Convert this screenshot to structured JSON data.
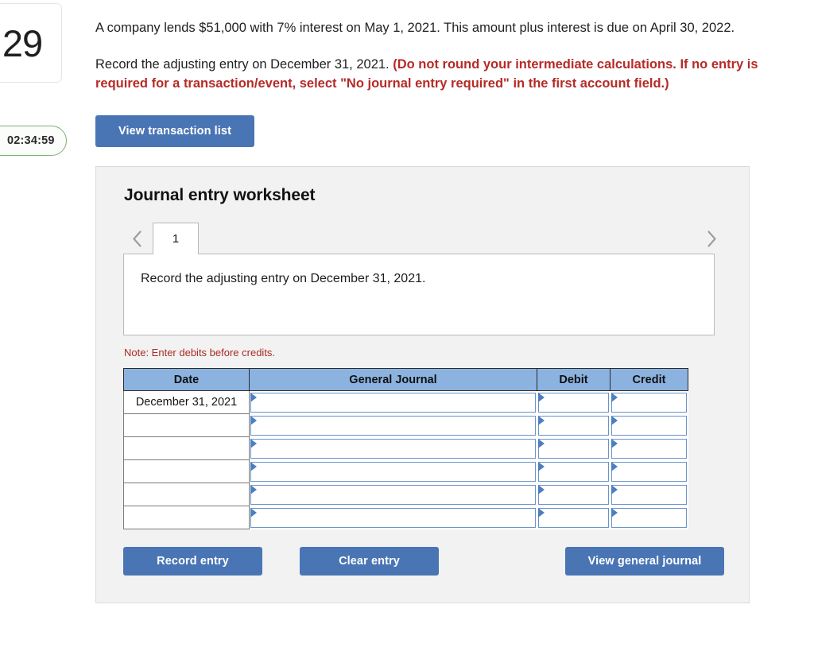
{
  "question": {
    "number": "29",
    "timer": "02:34:59",
    "timer_icon": "hourglass-icon"
  },
  "prompt": {
    "paragraph_1": "A company lends $51,000 with 7% interest on May 1, 2021. This amount plus interest is due on April 30, 2022.",
    "paragraph_2_plain": "Record the adjusting entry on December 31, 2021. ",
    "paragraph_2_emphasis": "(Do not round your intermediate calculations. If no entry is required for a transaction/event, select \"No journal entry required\" in the first account field.)"
  },
  "toolbar": {
    "view_transaction_list_label": "View transaction list"
  },
  "worksheet": {
    "title": "Journal entry worksheet",
    "prev_icon": "chevron-left-icon",
    "next_icon": "chevron-right-icon",
    "tabs": [
      {
        "label": "1",
        "active": true
      }
    ],
    "instruction": "Record the adjusting entry on December 31, 2021.",
    "note": "Note: Enter debits before credits.",
    "table": {
      "columns": [
        "Date",
        "General Journal",
        "Debit",
        "Credit"
      ],
      "rows": [
        {
          "date": "December 31, 2021",
          "general_journal": "",
          "debit": "",
          "credit": ""
        },
        {
          "date": "",
          "general_journal": "",
          "debit": "",
          "credit": ""
        },
        {
          "date": "",
          "general_journal": "",
          "debit": "",
          "credit": ""
        },
        {
          "date": "",
          "general_journal": "",
          "debit": "",
          "credit": ""
        },
        {
          "date": "",
          "general_journal": "",
          "debit": "",
          "credit": ""
        },
        {
          "date": "",
          "general_journal": "",
          "debit": "",
          "credit": ""
        }
      ]
    },
    "actions": {
      "record_entry_label": "Record entry",
      "clear_entry_label": "Clear entry",
      "view_general_journal_label": "View general journal"
    }
  },
  "colors": {
    "button_blue": "#4a75b5",
    "table_header_blue": "#8cb3e0",
    "cell_border_blue": "#6a93c8",
    "emphasis_red": "#b52b27",
    "note_red": "#aa2b24",
    "timer_green": "#7fae74",
    "panel_gray": "#f2f2f2"
  }
}
